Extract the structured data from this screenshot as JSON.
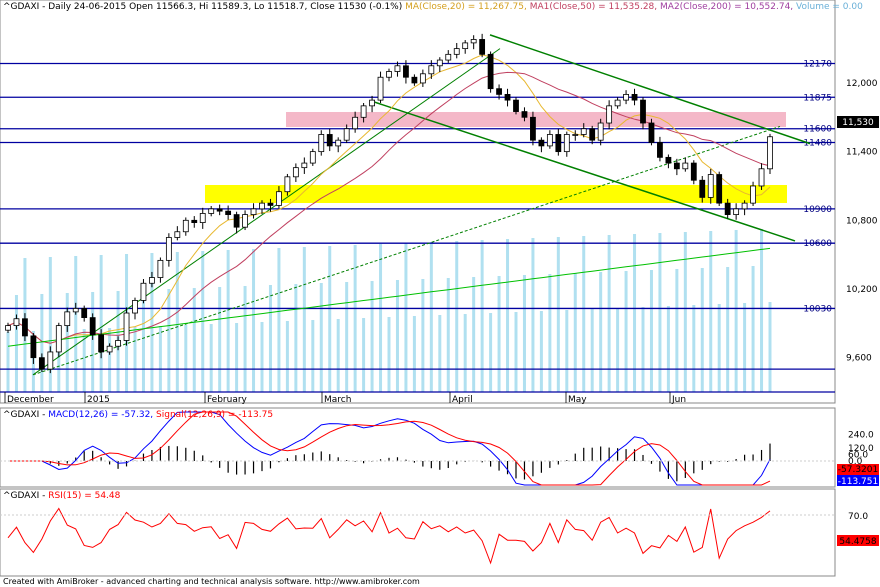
{
  "chart_data": {
    "type": "candlestick",
    "main": {
      "ticker": "^GDAXI",
      "period": "Daily",
      "date": "24-06-2015",
      "open_label": "Open 11566.3",
      "high_label": "Hi 11589.3",
      "low_label": "Lo 11518.7",
      "close_label": "Close 11530 (-0.1%)",
      "ma20_label": "MA(Close,20) = 11,267.75,",
      "ma50_label": "MA1(Close,50) = 11,535.28,",
      "ma200_label": "MA2(Close,200) = 10,552.74,",
      "volume_label": "Volume = 0.00",
      "last_price": "11,530",
      "ylim": [
        9300,
        12550
      ],
      "yticks": [
        "12,000",
        "11,400",
        "10,800",
        "10,200",
        "9,600"
      ],
      "levels": [
        "12170",
        "11875",
        "11600",
        "11480",
        "10900",
        "10600",
        "10030"
      ],
      "months": [
        "December",
        "2015",
        "February",
        "March",
        "April",
        "May",
        "Jun"
      ],
      "closes": [
        9880,
        9940,
        9790,
        9600,
        9500,
        9650,
        9880,
        10000,
        10030,
        9950,
        9800,
        9650,
        9700,
        9750,
        9990,
        10100,
        10250,
        10300,
        10450,
        10650,
        10700,
        10800,
        10780,
        10860,
        10900,
        10880,
        10850,
        10740,
        10850,
        10900,
        10950,
        10930,
        11050,
        11180,
        11260,
        11300,
        11400,
        11550,
        11450,
        11500,
        11600,
        11700,
        11800,
        11850,
        12050,
        12100,
        12150,
        12050,
        12000,
        12080,
        12150,
        12200,
        12250,
        12300,
        12350,
        12380,
        12250,
        11950,
        11900,
        11850,
        11750,
        11700,
        11500,
        11450,
        11550,
        11400,
        11550,
        11550,
        11600,
        11500,
        11650,
        11800,
        11850,
        11900,
        11850,
        11650,
        11480,
        11350,
        11300,
        11250,
        11300,
        11150,
        11000,
        11200,
        10950,
        10850,
        10900,
        10950,
        11100,
        11250,
        11530
      ],
      "ma20_note": "MA(Close,20)",
      "ma50_note": "MA1(Close,50)",
      "ma200_note": "MA2(Close,200)"
    },
    "macd": {
      "label_ticker": "^GDAXI",
      "macd_label": "MACD(12,26) = -57.32,",
      "signal_label": "Signal(12,26,9) = -113.75",
      "yticks": [
        "240.0",
        "120.0",
        "60.0",
        "0.0"
      ],
      "macd_value": "-57.3201",
      "signal_value": "-113.751"
    },
    "rsi": {
      "label_ticker": "^GDAXI",
      "rsi_label": "RSI(15) = 54.48",
      "yticks": [
        "70.0"
      ],
      "rsi_value": "54.4758"
    },
    "footer": "Created with AmiBroker - advanced charting and technical analysis software. http://www.amibroker.com",
    "colors": {
      "up": "#ffffff",
      "down": "#000000",
      "level": "#0000a0",
      "resist_band": "#f4b8c8",
      "support_band": "#ffff00",
      "channel": "#008000",
      "ma20": "#e8b830",
      "ma50": "#c04060",
      "ma200": "#00c000",
      "volume": "#b0e0f0",
      "macd": "#0000ff",
      "signal": "#ff0000",
      "rsi": "#ff0000"
    }
  }
}
